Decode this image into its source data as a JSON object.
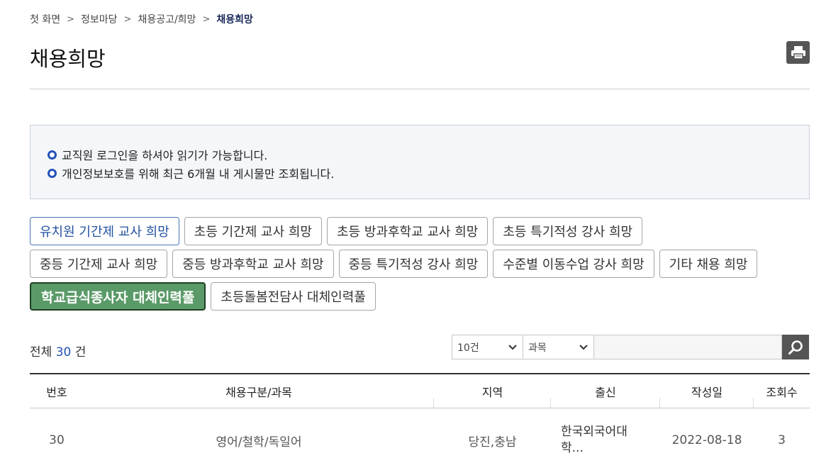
{
  "breadcrumb": {
    "home": "첫 화면",
    "level1": "정보마당",
    "level2": "채용공고/희망",
    "current": "채용희망"
  },
  "page_title": "채용희망",
  "notice": [
    "교직원 로그인을 하셔야 읽기가 가능합니다.",
    "개인정보보호를 위해 최근 6개월 내 게시물만 조회됩니다."
  ],
  "categories": {
    "row1": [
      "유치원 기간제 교사 희망",
      "초등 기간제 교사 희망",
      "초등 방과후학교 교사 희망",
      "초등 특기적성 강사 희망"
    ],
    "row2": [
      "중등 기간제 교사 희망",
      "중등 방과후학교 교사 희망",
      "중등 특기적성 강사 희망",
      "수준별 이동수업 강사 희망",
      "기타 채용 희망"
    ],
    "row3": [
      "학교급식종사자 대체인력풀",
      "초등돌봄전담사 대체인력풀"
    ],
    "active": "유치원 기간제 교사 희망"
  },
  "total": {
    "prefix": "전체",
    "count": "30",
    "suffix": "건"
  },
  "search": {
    "count_select": "10건",
    "subject_select": "과목",
    "input_value": ""
  },
  "table": {
    "headers": [
      "번호",
      "채용구분/과목",
      "지역",
      "출신",
      "작성일",
      "조회수"
    ],
    "rows": [
      {
        "no": "30",
        "subject": "영어/철학/독일어",
        "region": "당진,충남",
        "origin": "한국외국어대학...",
        "date": "2022-08-18",
        "views": "3"
      }
    ]
  },
  "colors": {
    "accent_blue": "#2352b8",
    "green_button": "#5a9a68",
    "dark_icon_bg": "#555555"
  },
  "icons": {
    "print": "printer-icon",
    "search": "magnifier-icon",
    "chevron": "chevron-down-icon",
    "bullet": "circle-bullet-icon"
  }
}
